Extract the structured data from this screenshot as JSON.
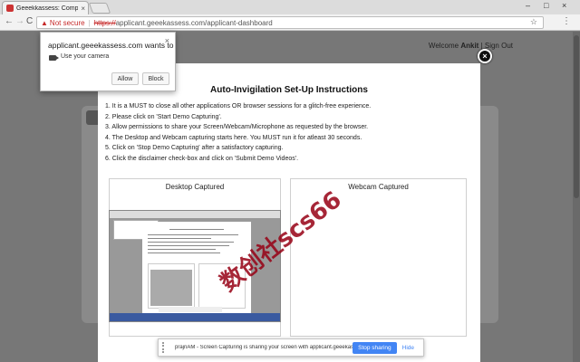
{
  "browser": {
    "tab_title": "Geeekkassess: Comprehens",
    "tab_close": "×",
    "window_controls": [
      "–",
      "□",
      "×"
    ],
    "nav": {
      "back": "←",
      "forward": "→",
      "reload": "C"
    },
    "omnibox": {
      "warning_icon": "▲",
      "not_secure": "Not secure",
      "separator": "|",
      "https": "https://",
      "url_rest": "applicant.geeekassess.com/applicant-dashboard",
      "star": "☆"
    },
    "menu": "⋮"
  },
  "header": {
    "welcome_prefix": "Welcome ",
    "user_name": "Ankit",
    "separator": " | ",
    "sign_out": "Sign Out"
  },
  "permission_popup": {
    "title": "applicant.geeekassess.com wants to",
    "close": "×",
    "camera_text": "Use your camera",
    "allow_label": "Allow",
    "block_label": "Block",
    "camera_icon": "camera-icon"
  },
  "modal": {
    "close": "×",
    "title": "Auto-Invigilation Set-Up Instructions",
    "instructions": [
      "1. It is a MUST to close all other applications OR browser sessions for a glitch-free experience.",
      "2. Please click on 'Start Demo Capturing'.",
      "3. Allow permissions to share your Screen/Webcam/Microphone as requested by the browser.",
      "4. The Desktop and Webcam capturing starts here. You MUST run it for atleast 30 seconds.",
      "5. Click on 'Stop Demo Capturing' after a satisfactory capturing.",
      "6. Click the disclaimer check-box and click on 'Submit Demo Videos'."
    ],
    "desktop_title": "Desktop Captured",
    "webcam_title": "Webcam Captured"
  },
  "watermark": "数创社scs66",
  "share_bar": {
    "text": "prajnAM - Screen Capturing is sharing your screen with applicant.geeekassess.com.",
    "stop_label": "Stop sharing",
    "hide_label": "Hide"
  },
  "colors": {
    "warning_red": "#c62828",
    "link_blue": "#4285f4",
    "overlay_gray": "#777777"
  }
}
